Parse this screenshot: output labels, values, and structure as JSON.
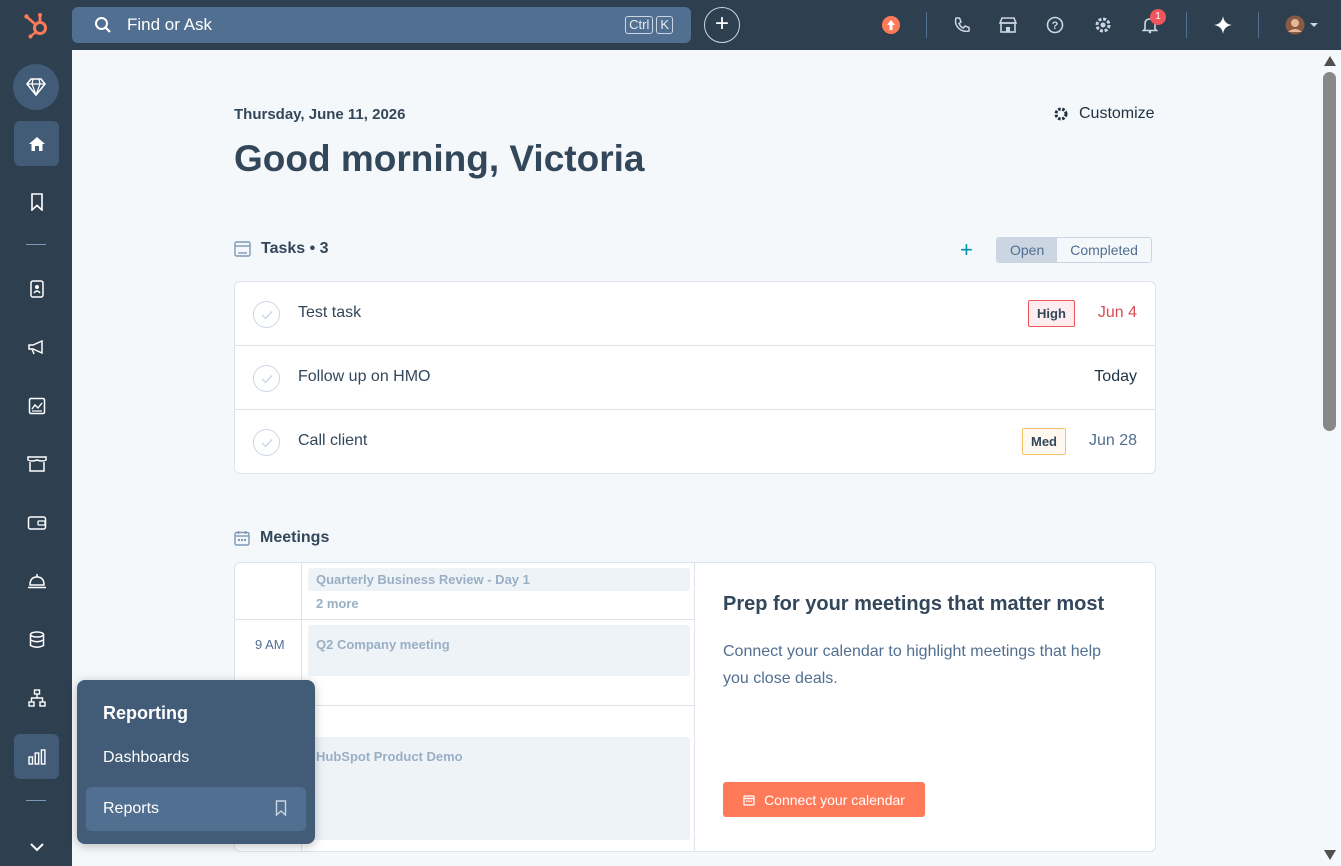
{
  "topbar": {
    "search_placeholder": "Find or Ask",
    "kbd_ctrl": "Ctrl",
    "kbd_k": "K",
    "plus": "+",
    "notification_count": "1",
    "accent": "#ff7a59"
  },
  "sidebar": {
    "icons": [
      "diamond-icon",
      "home-icon",
      "bookmark-icon",
      "contacts-icon",
      "megaphone-icon",
      "content-icon",
      "commerce-icon",
      "wallet-icon",
      "service-bell-icon",
      "database-icon",
      "hierarchy-icon",
      "reporting-icon",
      "chevron-down-icon"
    ]
  },
  "main": {
    "date": "Thursday, June 11, 2026",
    "greeting": "Good morning, Victoria",
    "customize": "Customize",
    "tasks": {
      "title": "Tasks • 3",
      "add": "+",
      "toggle_open": "Open",
      "toggle_completed": "Completed",
      "items": [
        {
          "name": "Test task",
          "priority": "High",
          "due": "Jun 4",
          "due_color": "#d94c53"
        },
        {
          "name": "Follow up on HMO",
          "priority": "",
          "due": "Today",
          "due_color": "#213343"
        },
        {
          "name": "Call client",
          "priority": "Med",
          "due": "Jun 28",
          "due_color": "#516f90"
        }
      ]
    },
    "meetings": {
      "title": "Meetings",
      "time_9am": "9 AM",
      "events": [
        "Quarterly Business Review - Day 1",
        "Q2 Company meeting",
        "HubSpot Product Demo"
      ],
      "more": "2 more",
      "prep_title": "Prep for your meetings that matter most",
      "prep_desc": "Connect your calendar to highlight meetings that help you close deals.",
      "connect_button": "Connect your calendar"
    }
  },
  "flyout": {
    "title": "Reporting",
    "item_dashboards": "Dashboards",
    "item_reports": "Reports"
  }
}
